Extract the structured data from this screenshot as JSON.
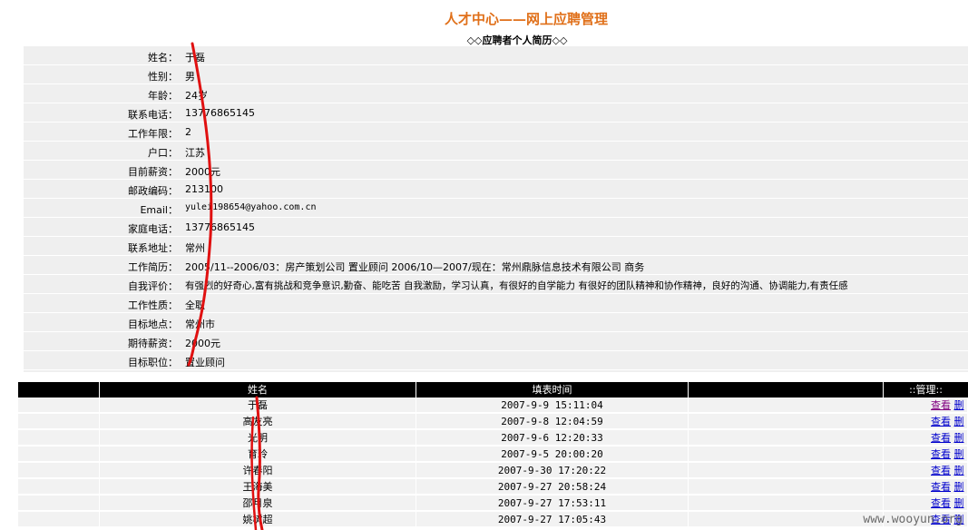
{
  "header": {
    "title": "人才中心——网上应聘管理",
    "subtitle": "◇◇应聘者个人简历◇◇"
  },
  "resume": [
    {
      "label": "姓名：",
      "value": "于磊"
    },
    {
      "label": "性别：",
      "value": "男"
    },
    {
      "label": "年龄：",
      "value": "24岁"
    },
    {
      "label": "联系电话：",
      "value": "13776865145"
    },
    {
      "label": "工作年限：",
      "value": "2"
    },
    {
      "label": "户口：",
      "value": "江苏"
    },
    {
      "label": "目前薪资：",
      "value": "2000元"
    },
    {
      "label": "邮政编码：",
      "value": "213100"
    },
    {
      "label": "Email：",
      "value": "yulei198654@yahoo.com.cn"
    },
    {
      "label": "家庭电话：",
      "value": "13776865145"
    },
    {
      "label": "联系地址：",
      "value": "常州"
    },
    {
      "label": "工作简历：",
      "value": "2005/11--2006/03：房产策划公司 置业顾问 2006/10—2007/现在：常州鼎脉信息技术有限公司 商务"
    },
    {
      "label": "自我评价：",
      "value": "有强烈的好奇心,富有挑战和竞争意识,勤奋、能吃苦 自我激励，学习认真，有很好的自学能力 有很好的团队精神和协作精神，良好的沟通、协调能力,有责任感"
    },
    {
      "label": "工作性质：",
      "value": "全职"
    },
    {
      "label": "目标地点：",
      "value": "常州市"
    },
    {
      "label": "期待薪资：",
      "value": "2000元"
    },
    {
      "label": "目标职位：",
      "value": "置业顾问"
    }
  ],
  "list": {
    "headers": [
      "",
      "姓名",
      "填表时间",
      "",
      "::管理::"
    ],
    "actions": {
      "view": "查看",
      "delete": "删"
    },
    "rows": [
      {
        "name": "于磊",
        "time": "2007-9-9 15:11:04"
      },
      {
        "name": "高友亮",
        "time": "2007-9-8 12:04:59"
      },
      {
        "name": "光明",
        "time": "2007-9-6 12:20:33"
      },
      {
        "name": "育玲",
        "time": "2007-9-5 20:00:20"
      },
      {
        "name": "许春阳",
        "time": "2007-9-30 17:20:22"
      },
      {
        "name": "王海美",
        "time": "2007-9-27 20:58:24"
      },
      {
        "name": "邵月泉",
        "time": "2007-9-27 17:53:11"
      },
      {
        "name": "姚树超",
        "time": "2007-9-27 17:05:43"
      }
    ]
  },
  "watermark": "www.wooyun.org",
  "colors": {
    "title": "#e0701a",
    "annotation": "#e01010",
    "link": "#0000cc"
  }
}
